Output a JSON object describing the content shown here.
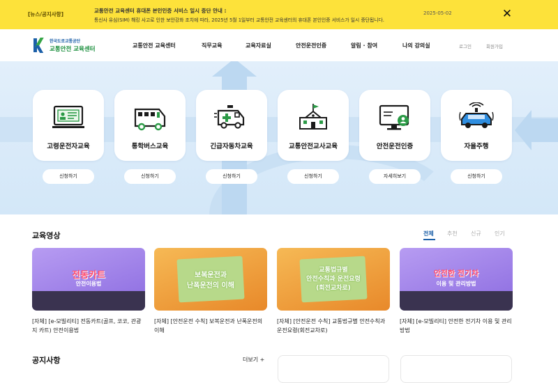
{
  "notice": {
    "tag": "[뉴스/공지사항]",
    "headline": "교통안전 교육센터 휴대폰 본인인증 서비스 일시 중단 안내 :",
    "body": "통신사 유심(SIM) 해킹 사고로 인한 보안강화 조치에 따라, 2025년 5월 1일부터 교통안전 교육센터의 휴대폰 본인인증 서비스가 일시 중단됩니다.",
    "date": "2025-05-02",
    "close_symbol": "✕"
  },
  "header": {
    "logo_line1": "한국도로교통공단",
    "logo_line2": "교통안전 교육센터",
    "nav": [
      "교통안전 교육센터",
      "직무교육",
      "교육자료실",
      "안전운전인증",
      "알림 · 참여",
      "나의 강의실"
    ],
    "login": "로그인",
    "signup": "회원가입"
  },
  "services": [
    {
      "label": "고령운전자교육",
      "button": "신청하기",
      "icon": "elderly-driver-monitor-icon"
    },
    {
      "label": "통학버스교육",
      "button": "신청하기",
      "icon": "school-bus-icon"
    },
    {
      "label": "긴급자동차교육",
      "button": "신청하기",
      "icon": "ambulance-icon"
    },
    {
      "label": "교통안전교사교육",
      "button": "신청하기",
      "icon": "school-building-icon"
    },
    {
      "label": "안전운전인증",
      "button": "자세히보기",
      "icon": "certified-monitor-icon"
    },
    {
      "label": "자율주행",
      "button": "신청하기",
      "icon": "autonomous-car-icon"
    }
  ],
  "videos": {
    "title": "교육영상",
    "tabs": [
      "전체",
      "추천",
      "신규",
      "인기"
    ],
    "active_tab": "전체",
    "items": [
      {
        "caption": "[자체] [e-모빌리티] 전동카트(골프, 코코, 관광지 카트) 안전이용법",
        "thumb_line1": "전동카트",
        "thumb_line2": "안전이용법",
        "theme": "#9a7be6"
      },
      {
        "caption": "[자체] [안전운전 수칙] 보복운전과 난폭운전의 이해",
        "thumb_line1": "보복운전과",
        "thumb_line2": "난폭운전의 이해",
        "theme": "#f2a23a"
      },
      {
        "caption": "[자체] [안전운전 수칙] 교통법규별 안전수칙과 운전요령(회전교차로)",
        "thumb_line1": "교통법규별",
        "thumb_line2": "안전수칙과 운전요령",
        "thumb_line3": "(회전교차로)",
        "theme": "#f2a23a"
      },
      {
        "caption": "[자체] [e-모빌리티] 안전한 전기차 이용 및 관리방법",
        "thumb_line1": "안전한 전기차",
        "thumb_line2": "이용 및 관리방법",
        "theme": "#9a7be6"
      }
    ]
  },
  "notices": {
    "title": "공지사항",
    "more": "더보기 +"
  }
}
